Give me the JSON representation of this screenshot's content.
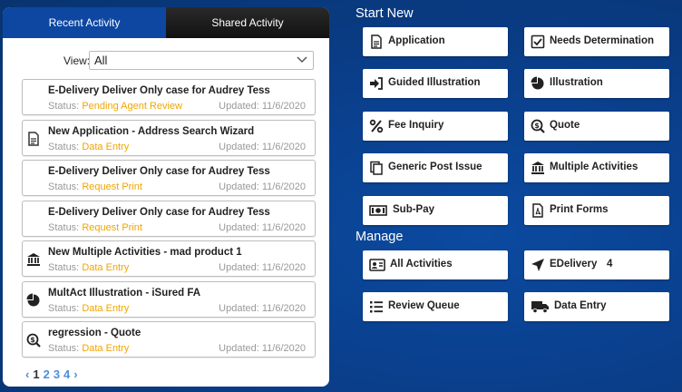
{
  "tabs": [
    {
      "label": "Recent Activity",
      "active": true
    },
    {
      "label": "Shared Activity",
      "active": false
    }
  ],
  "view": {
    "label": "View:",
    "selected": "All"
  },
  "activities": [
    {
      "icon": "none",
      "title": "E-Delivery Deliver Only case for Audrey Tess",
      "status_label": "Status:",
      "status": "Pending Agent Review",
      "updated": "Updated: 11/6/2020"
    },
    {
      "icon": "document-icon",
      "title": "New Application - Address Search Wizard",
      "status_label": "Status:",
      "status": "Data Entry",
      "updated": "Updated: 11/6/2020"
    },
    {
      "icon": "none",
      "title": "E-Delivery Deliver Only case for Audrey Tess",
      "status_label": "Status:",
      "status": "Request Print",
      "updated": "Updated: 11/6/2020"
    },
    {
      "icon": "none",
      "title": "E-Delivery Deliver Only case for Audrey Tess",
      "status_label": "Status:",
      "status": "Request Print",
      "updated": "Updated: 11/6/2020"
    },
    {
      "icon": "bank-icon",
      "title": "New Multiple Activities - mad product 1",
      "status_label": "Status:",
      "status": "Data Entry",
      "updated": "Updated: 11/6/2020"
    },
    {
      "icon": "pie-chart-icon",
      "title": "MultAct Illustration - iSured FA",
      "status_label": "Status:",
      "status": "Data Entry",
      "updated": "Updated: 11/6/2020"
    },
    {
      "icon": "dollar-search-icon",
      "title": "regression - Quote",
      "status_label": "Status:",
      "status": "Data Entry",
      "updated": "Updated: 11/6/2020"
    }
  ],
  "pager": {
    "prev": "‹",
    "pages": [
      "1",
      "2",
      "3",
      "4"
    ],
    "next": "›",
    "current": "1"
  },
  "start_new": {
    "title": "Start New",
    "buttons": [
      {
        "label": "Application",
        "icon": "document-icon"
      },
      {
        "label": "Needs Determination",
        "icon": "checkbox-icon"
      },
      {
        "label": "Guided Illustration",
        "icon": "sign-in-icon"
      },
      {
        "label": "Illustration",
        "icon": "pie-chart-icon"
      },
      {
        "label": "Fee Inquiry",
        "icon": "percent-icon"
      },
      {
        "label": "Quote",
        "icon": "dollar-search-icon"
      },
      {
        "label": "Generic Post Issue",
        "icon": "copy-icon"
      },
      {
        "label": "Multiple Activities",
        "icon": "bank-icon"
      },
      {
        "label": "Sub-Pay",
        "icon": "money-icon"
      },
      {
        "label": "Print Forms",
        "icon": "pdf-icon"
      }
    ]
  },
  "manage": {
    "title": "Manage",
    "buttons": [
      {
        "label": "All Activities",
        "icon": "id-card-icon"
      },
      {
        "label": "EDelivery",
        "icon": "location-arrow-icon",
        "badge": "4"
      },
      {
        "label": "Review Queue",
        "icon": "list-icon"
      },
      {
        "label": "Data Entry",
        "icon": "truck-icon"
      }
    ]
  },
  "colors": {
    "accent": "#0d47a1",
    "status": "#f0a500",
    "pager_link": "#4a90d9"
  }
}
